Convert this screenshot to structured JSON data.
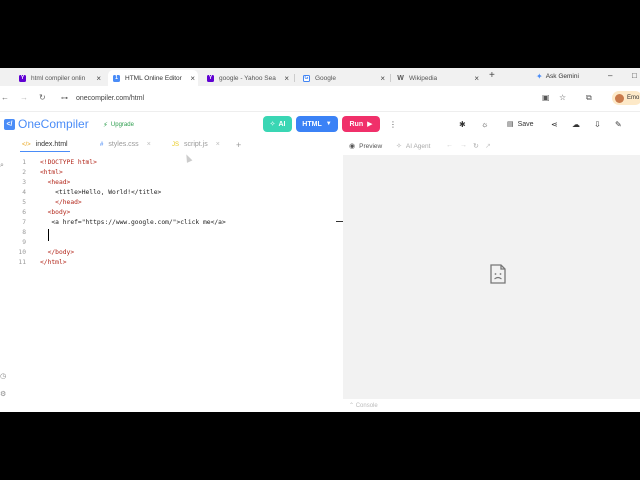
{
  "browser": {
    "tabs": [
      {
        "title": "html compiler onlin",
        "icon": "yahoo-icon",
        "color": "#6001d2",
        "active": false
      },
      {
        "title": "HTML Online Editor",
        "icon": "onecompiler-icon",
        "color": "#4a8cf7",
        "active": true
      },
      {
        "title": "google - Yahoo Sea",
        "icon": "yahoo-icon",
        "color": "#6001d2",
        "active": false
      },
      {
        "title": "Google",
        "icon": "google-icon",
        "color": "#4285f4",
        "active": false
      },
      {
        "title": "Wikipedia",
        "icon": "wikipedia-icon",
        "color": "#555555",
        "active": false
      }
    ],
    "ask_gemini": "Ask Gemini",
    "url": "onecompiler.com/html",
    "profile_label": "Emo"
  },
  "app": {
    "logo_text": "OneCompiler",
    "upgrade_label": "Upgrade",
    "ai_label": "AI",
    "language_label": "HTML",
    "run_label": "Run",
    "save_label": "Save",
    "accent": "#4a8cf7",
    "run_color": "#f0306a",
    "ai_color": "#3ad6b4"
  },
  "files": [
    {
      "name": "index.html",
      "active": true
    },
    {
      "name": "styles.css",
      "active": false
    },
    {
      "name": "script.js",
      "active": false
    }
  ],
  "code": {
    "lines": [
      "<!DOCTYPE html>",
      "<html>",
      "  <head>",
      "    <title>Hello, World!</title>",
      "    </head>",
      "  <body>",
      "   <a href=\"https://www.google.com/\">click me</a>",
      "",
      "",
      "  </body>",
      "</html>"
    ]
  },
  "preview": {
    "tab_preview": "Preview",
    "tab_agent": "AI Agent",
    "console_label": "Console"
  }
}
